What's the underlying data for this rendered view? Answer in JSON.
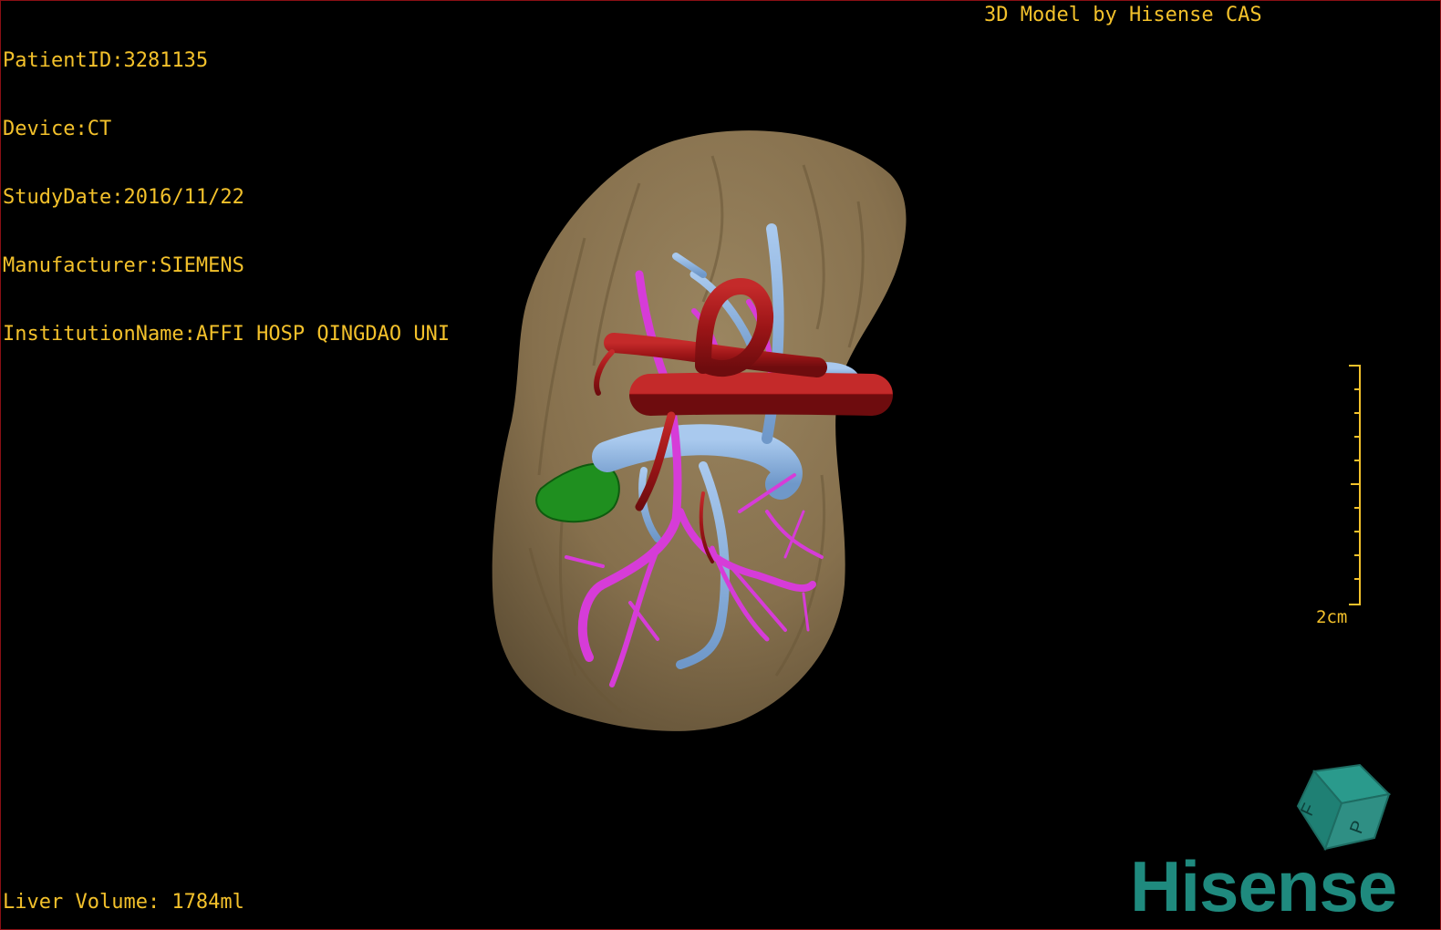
{
  "viewport": {
    "info_lines": [
      "PatientID:3281135",
      "Device:CT",
      "StudyDate:2016/11/22",
      "Manufacturer:SIEMENS",
      "InstitutionName:AFFI HOSP QINGDAO UNI"
    ],
    "credit": "3D Model by Hisense CAS",
    "liver_volume": "Liver Volume: 1784ml",
    "scale_bar": {
      "label": "2cm"
    },
    "orientation_cube": {
      "face_labels": [
        "F",
        "P"
      ]
    },
    "brand": "Hisense"
  },
  "colors": {
    "overlay_text": "#f3c12b",
    "liver": "#8b7550",
    "hepatic_artery": "#a3161a",
    "portal_vein": "#8fb7e6",
    "hepatic_vein": "#d83ad9",
    "tumor": "#1f8a1f",
    "brand": "#1f8a7e"
  }
}
